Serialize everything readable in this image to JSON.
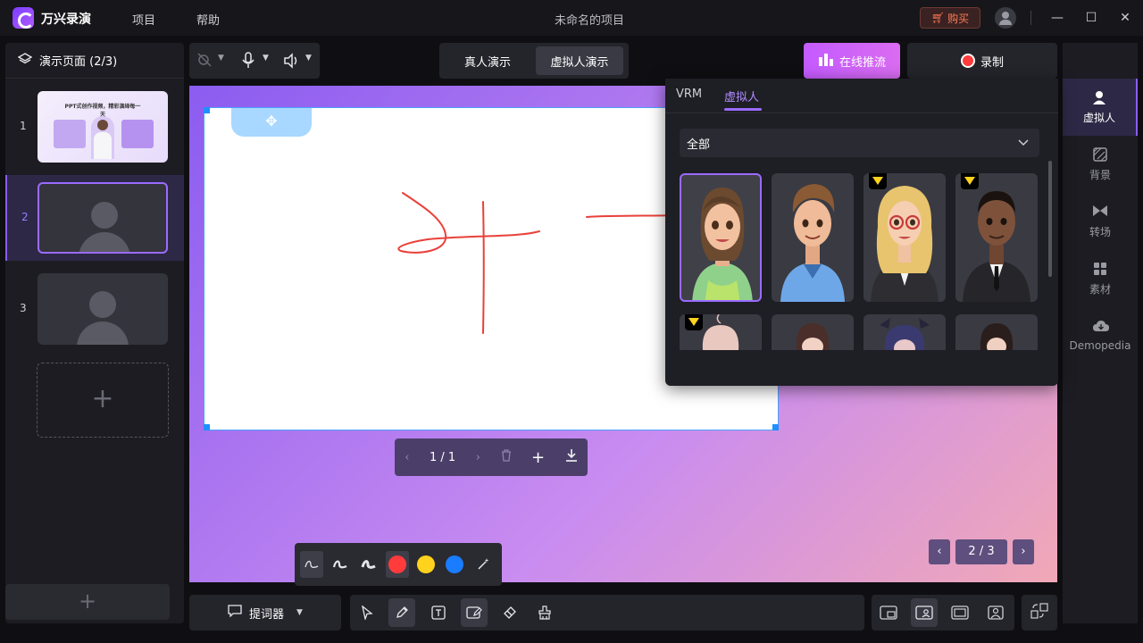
{
  "titlebar": {
    "app_name": "万兴录演",
    "menu": [
      "项目",
      "帮助"
    ],
    "project_title": "未命名的项目",
    "buy_label": "购买",
    "window_controls": [
      "minimize",
      "maximize",
      "close"
    ]
  },
  "left_panel": {
    "header": "演示页面 (2/3)",
    "slides": [
      {
        "num": "1",
        "thumb_text": "PPT式创作视频，精彩演绎每一天"
      },
      {
        "num": "2"
      },
      {
        "num": "3"
      }
    ],
    "add_symbol": "+"
  },
  "top_toolbar": {
    "modes": [
      "真人演示",
      "虚拟人演示"
    ],
    "active_mode": "虚拟人演示",
    "stream_label": "在线推流",
    "record_label": "录制"
  },
  "canvas": {
    "page_indicator": "1 / 1",
    "slide_counter": "2 / 3"
  },
  "pen_tools": {
    "colors": [
      "#ff3b3b",
      "#ffd21e",
      "#1a7cff"
    ],
    "selected_color": "#ff3b3b"
  },
  "bottom": {
    "prompter_label": "提词器"
  },
  "right_rail": {
    "items": [
      {
        "label": "虚拟人",
        "icon": "avatar-icon"
      },
      {
        "label": "背景",
        "icon": "background-icon"
      },
      {
        "label": "转场",
        "icon": "transition-icon"
      },
      {
        "label": "素材",
        "icon": "material-icon"
      },
      {
        "label": "Demopedia",
        "icon": "cloud-icon"
      }
    ],
    "active": "虚拟人"
  },
  "avatar_panel": {
    "tabs": [
      "VRM",
      "虚拟人"
    ],
    "active_tab": "虚拟人",
    "filter_value": "全部",
    "avatars": [
      {
        "name": "female-casual-avatar",
        "premium": false,
        "selected": true
      },
      {
        "name": "male-casual-avatar",
        "premium": false,
        "selected": false
      },
      {
        "name": "female-business-avatar",
        "premium": true,
        "selected": false
      },
      {
        "name": "male-business-avatar",
        "premium": true,
        "selected": false
      },
      {
        "name": "anime-avatar-1",
        "premium": true,
        "selected": false
      },
      {
        "name": "anime-avatar-2",
        "premium": false,
        "selected": false
      },
      {
        "name": "anime-avatar-3",
        "premium": false,
        "selected": false
      },
      {
        "name": "anime-avatar-4",
        "premium": false,
        "selected": false
      }
    ]
  },
  "colors": {
    "accent": "#9a6bff",
    "stream_gradient": "#c45bff",
    "record_red": "#ff3b3b",
    "ink": "#e8413a"
  }
}
